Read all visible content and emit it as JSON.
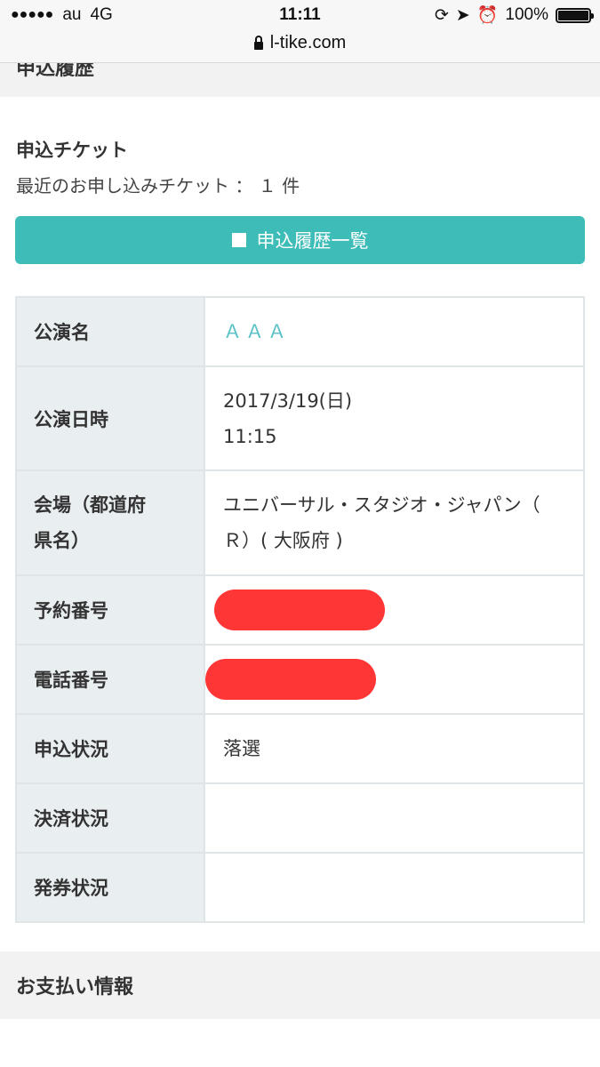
{
  "status_bar": {
    "carrier": "au",
    "network": "4G",
    "time": "11:11",
    "battery": "100%"
  },
  "url_bar": {
    "url": "l-tike.com"
  },
  "section_top": {
    "title": "申込履歴"
  },
  "ticket": {
    "title": "申込チケット",
    "recent": "最近のお申し込みチケット ： １ 件",
    "history_button": "申込履歴一覧"
  },
  "table": {
    "rows": [
      {
        "label": "公演名",
        "value": "ＡＡＡ"
      },
      {
        "label": "公演日時",
        "value_line1": "2017/3/19(日)",
        "value_line2": "11:15"
      },
      {
        "label_line1": "会場（都道府",
        "label_line2": "県名）",
        "value_line1": "ユニバーサル・スタジオ・ジャパン（",
        "value_line2": "Ｒ）( 大阪府 )"
      },
      {
        "label": "予約番号"
      },
      {
        "label": "電話番号"
      },
      {
        "label": "申込状況",
        "value": "落選"
      },
      {
        "label": "決済状況",
        "value": ""
      },
      {
        "label": "発券状況",
        "value": ""
      }
    ]
  },
  "bottom_section": {
    "title": "お支払い情報"
  },
  "colors": {
    "accent": "#3dbcb8",
    "link": "#5bc2c8",
    "redaction": "#ff3636",
    "label_bg": "#e9eef0"
  }
}
